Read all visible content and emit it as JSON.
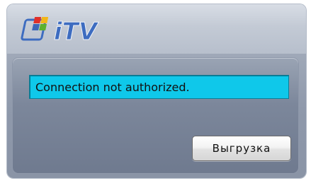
{
  "header": {
    "logo": {
      "text": "iTV",
      "icon": "itv-logo-icon",
      "colors": {
        "tile_red": "#e0302a",
        "tile_green": "#5cb12e",
        "tile_yellow": "#f2b619",
        "tile_blue": "#3d67b8",
        "text_blue": "#3d6cc0"
      }
    }
  },
  "status": {
    "message": "Connection not authorized.",
    "background_color": "#0fc8ea"
  },
  "actions": {
    "upload_label": "Выгрузка"
  }
}
